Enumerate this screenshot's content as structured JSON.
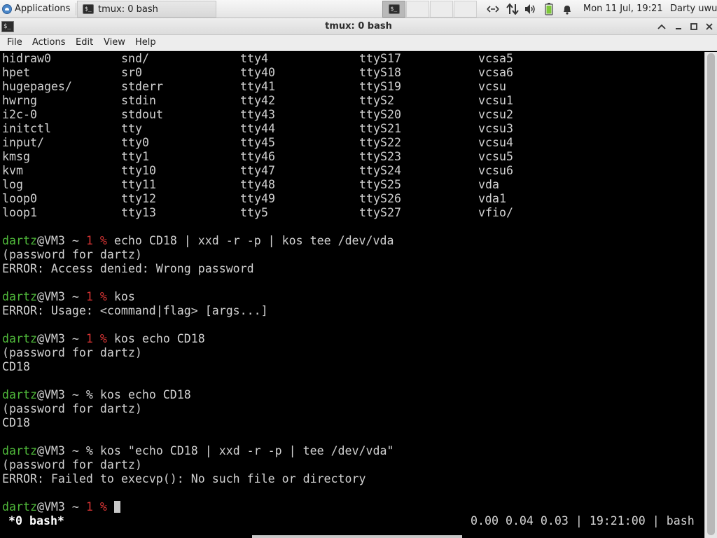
{
  "panel": {
    "applications_label": "Applications",
    "task_label": "tmux: 0 bash",
    "clock": "Mon 11 Jul, 19:21",
    "user": "Darty uwu",
    "tray_icons": [
      "network-icon",
      "transfer-icon",
      "volume-icon",
      "battery-icon",
      "notification-bell-icon"
    ]
  },
  "window": {
    "title": "tmux: 0 bash",
    "controls": [
      "minimize-up",
      "minimize",
      "maximize",
      "close"
    ]
  },
  "menubar": {
    "file": "File",
    "actions": "Actions",
    "edit": "Edit",
    "view": "View",
    "help": "Help"
  },
  "terminal": {
    "listing": [
      [
        "hidraw0",
        "snd/",
        "tty4",
        "ttyS17",
        "vcsa5"
      ],
      [
        "hpet",
        "sr0",
        "tty40",
        "ttyS18",
        "vcsa6"
      ],
      [
        "hugepages/",
        "stderr",
        "tty41",
        "ttyS19",
        "vcsu"
      ],
      [
        "hwrng",
        "stdin",
        "tty42",
        "ttyS2",
        "vcsu1"
      ],
      [
        "i2c-0",
        "stdout",
        "tty43",
        "ttyS20",
        "vcsu2"
      ],
      [
        "initctl",
        "tty",
        "tty44",
        "ttyS21",
        "vcsu3"
      ],
      [
        "input/",
        "tty0",
        "tty45",
        "ttyS22",
        "vcsu4"
      ],
      [
        "kmsg",
        "tty1",
        "tty46",
        "ttyS23",
        "vcsu5"
      ],
      [
        "kvm",
        "tty10",
        "tty47",
        "ttyS24",
        "vcsu6"
      ],
      [
        "log",
        "tty11",
        "tty48",
        "ttyS25",
        "vda"
      ],
      [
        "loop0",
        "tty12",
        "tty49",
        "ttyS26",
        "vda1"
      ],
      [
        "loop1",
        "tty13",
        "tty5",
        "ttyS27",
        "vfio/"
      ]
    ],
    "prompt_user": "dartz",
    "prompt_host": "@VM3 ~ ",
    "blocks": [
      {
        "exit": "1",
        "command": "echo CD18 | xxd -r -p | kos tee /dev/vda",
        "output": [
          "(password for dartz)",
          "ERROR: Access denied: Wrong password"
        ]
      },
      {
        "exit": "1",
        "command": "kos",
        "output": [
          "ERROR: Usage: <command|flag> [args...]"
        ]
      },
      {
        "exit": "1",
        "command": "kos echo CD18",
        "output": [
          "(password for dartz)",
          "CD18"
        ]
      },
      {
        "exit": "",
        "command": "kos echo CD18",
        "output": [
          "(password for dartz)",
          "CD18"
        ]
      },
      {
        "exit": "",
        "command": "kos \"echo CD18 | xxd -r -p | tee /dev/vda\"",
        "output": [
          "(password for dartz)",
          "ERROR: Failed to execvp(): No such file or directory"
        ]
      }
    ],
    "final_exit": "1",
    "prompt_symbol": "%"
  },
  "tmux_status": {
    "left": "*0 bash*",
    "right": "0.00 0.04 0.03 | 19:21:00 | bash"
  },
  "colors": {
    "prompt_user": "#4fb83a",
    "exit_code": "#d43333",
    "terminal_bg": "#000000",
    "terminal_fg": "#d0d0d0"
  }
}
